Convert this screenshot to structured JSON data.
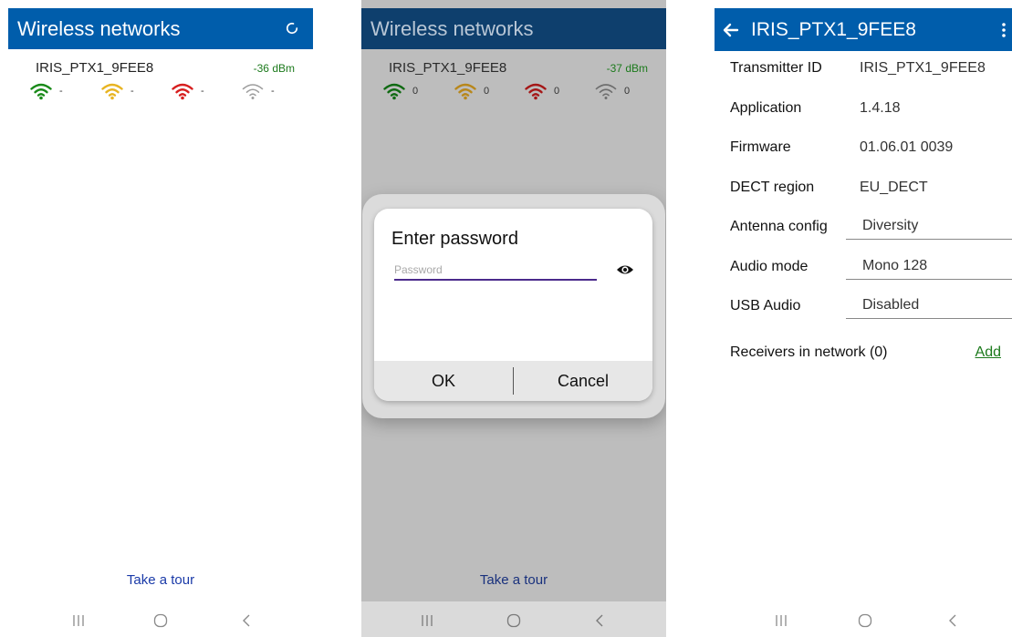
{
  "colors": {
    "green": "#1a8a1a",
    "yellow": "#e8b422",
    "red": "#d71f1f",
    "gray": "#9e9e9e",
    "primary": "#005dab"
  },
  "icons": {
    "refresh": "refresh-icon",
    "back": "arrow-left-icon",
    "menu": "more-vertical-icon",
    "eye": "eye-icon",
    "signal": "wifi-signal-icon"
  },
  "list_screen": {
    "title": "Wireless networks",
    "network": {
      "name": "IRIS_PTX1_9FEE8",
      "dbm": "-36 dBm",
      "counts": [
        "-",
        "-",
        "-",
        "-"
      ]
    },
    "tour_link": "Take a tour"
  },
  "dialog_screen": {
    "title": "Wireless networks",
    "network": {
      "name": "IRIS_PTX1_9FEE8",
      "dbm": "-37 dBm",
      "counts": [
        "0",
        "0",
        "0",
        "0"
      ]
    },
    "dialog": {
      "title": "Enter password",
      "password_placeholder": "Password",
      "password_value": "",
      "ok_label": "OK",
      "cancel_label": "Cancel"
    },
    "tour_link": "Take a tour"
  },
  "details_screen": {
    "title": "IRIS_PTX1_9FEE8",
    "rows": [
      {
        "label": "Transmitter ID",
        "value": "IRIS_PTX1_9FEE8"
      },
      {
        "label": "Application",
        "value": "1.4.18"
      },
      {
        "label": "Firmware",
        "value": "01.06.01 0039"
      },
      {
        "label": "DECT region",
        "value": "EU_DECT"
      },
      {
        "label": "Antenna config",
        "value": "Diversity"
      },
      {
        "label": "Audio mode",
        "value": "Mono 128"
      },
      {
        "label": "USB Audio",
        "value": "Disabled"
      }
    ],
    "receivers_label": "Receivers in network (0)",
    "add_label": "Add"
  }
}
